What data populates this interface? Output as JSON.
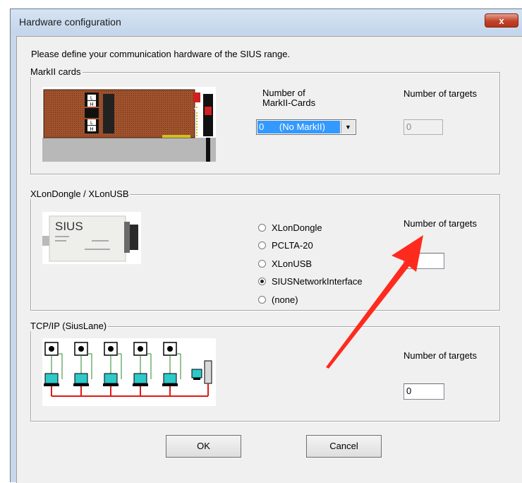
{
  "window": {
    "title": "Hardware configuration",
    "close_glyph": "x"
  },
  "intro_text": "Please define your communication hardware of the SIUS range.",
  "markII": {
    "legend": "MarkII cards",
    "image_icon": "markii-card-image",
    "card_labels": [
      "L",
      "H",
      "L",
      "H"
    ],
    "number_label_line1": "Number of",
    "number_label_line2": "MarkII-Cards",
    "cards_selected": "0      (No MarkII)",
    "targets_label": "Number of targets",
    "targets_value": "0"
  },
  "xlon": {
    "legend": "XLonDongle / XLonUSB",
    "image_icon": "sius-dongle-image",
    "device_brand": "SIUS",
    "options": [
      {
        "label": "XLonDongle",
        "checked": false
      },
      {
        "label": "PCLTA-20",
        "checked": false
      },
      {
        "label": "XLonUSB",
        "checked": false
      },
      {
        "label": "SIUSNetworkInterface",
        "checked": true
      },
      {
        "label": "(none)",
        "checked": false
      }
    ],
    "targets_label": "Number of targets",
    "targets_value": "10"
  },
  "tcpip": {
    "legend": "TCP/IP (SiusLane)",
    "image_icon": "network-lanes-image",
    "targets_label": "Number of targets",
    "targets_value": "0"
  },
  "buttons": {
    "ok": "OK",
    "cancel": "Cancel"
  },
  "annotation": {
    "icon": "red-arrow-icon",
    "color": "#ff2a1e"
  }
}
